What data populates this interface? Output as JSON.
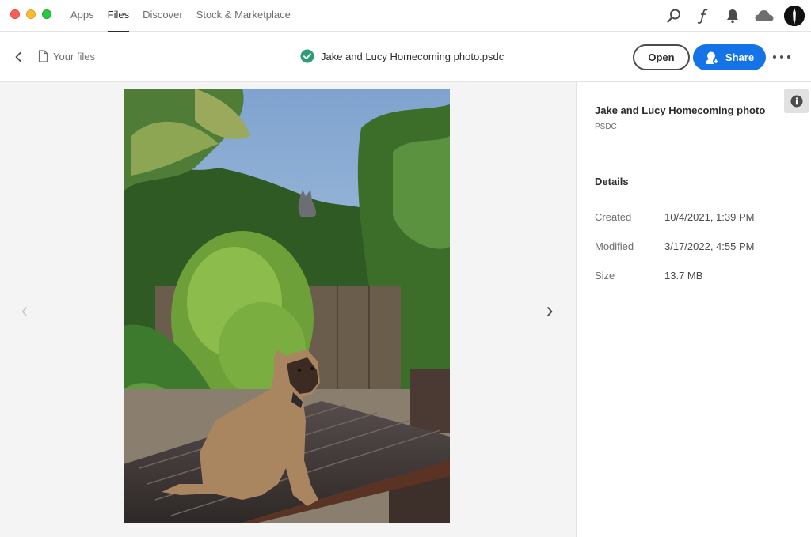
{
  "window": {
    "traffic_lights": [
      "close",
      "minimize",
      "zoom"
    ]
  },
  "topnav": {
    "tabs": [
      {
        "label": "Apps",
        "active": false
      },
      {
        "label": "Files",
        "active": true
      },
      {
        "label": "Discover",
        "active": false
      },
      {
        "label": "Stock & Marketplace",
        "active": false
      }
    ],
    "icons": [
      "search-icon",
      "fonts-icon",
      "bell-icon",
      "cloud-icon",
      "avatar"
    ]
  },
  "filebar": {
    "breadcrumb": "Your files",
    "title": "Jake and Lucy Homecoming photo.psdc",
    "status": "synced",
    "open_label": "Open",
    "share_label": "Share"
  },
  "panel": {
    "name": "Jake and Lucy Homecoming photo",
    "type": "PSDC",
    "details_heading": "Details",
    "details": [
      {
        "key": "Created",
        "value": "10/4/2021, 1:39 PM"
      },
      {
        "key": "Modified",
        "value": "3/17/2022, 4:55 PM"
      },
      {
        "key": "Size",
        "value": "13.7 MB"
      }
    ]
  },
  "colors": {
    "accent": "#1473e6",
    "success": "#2d9d78",
    "preview_bg": "#f4f4f4"
  }
}
